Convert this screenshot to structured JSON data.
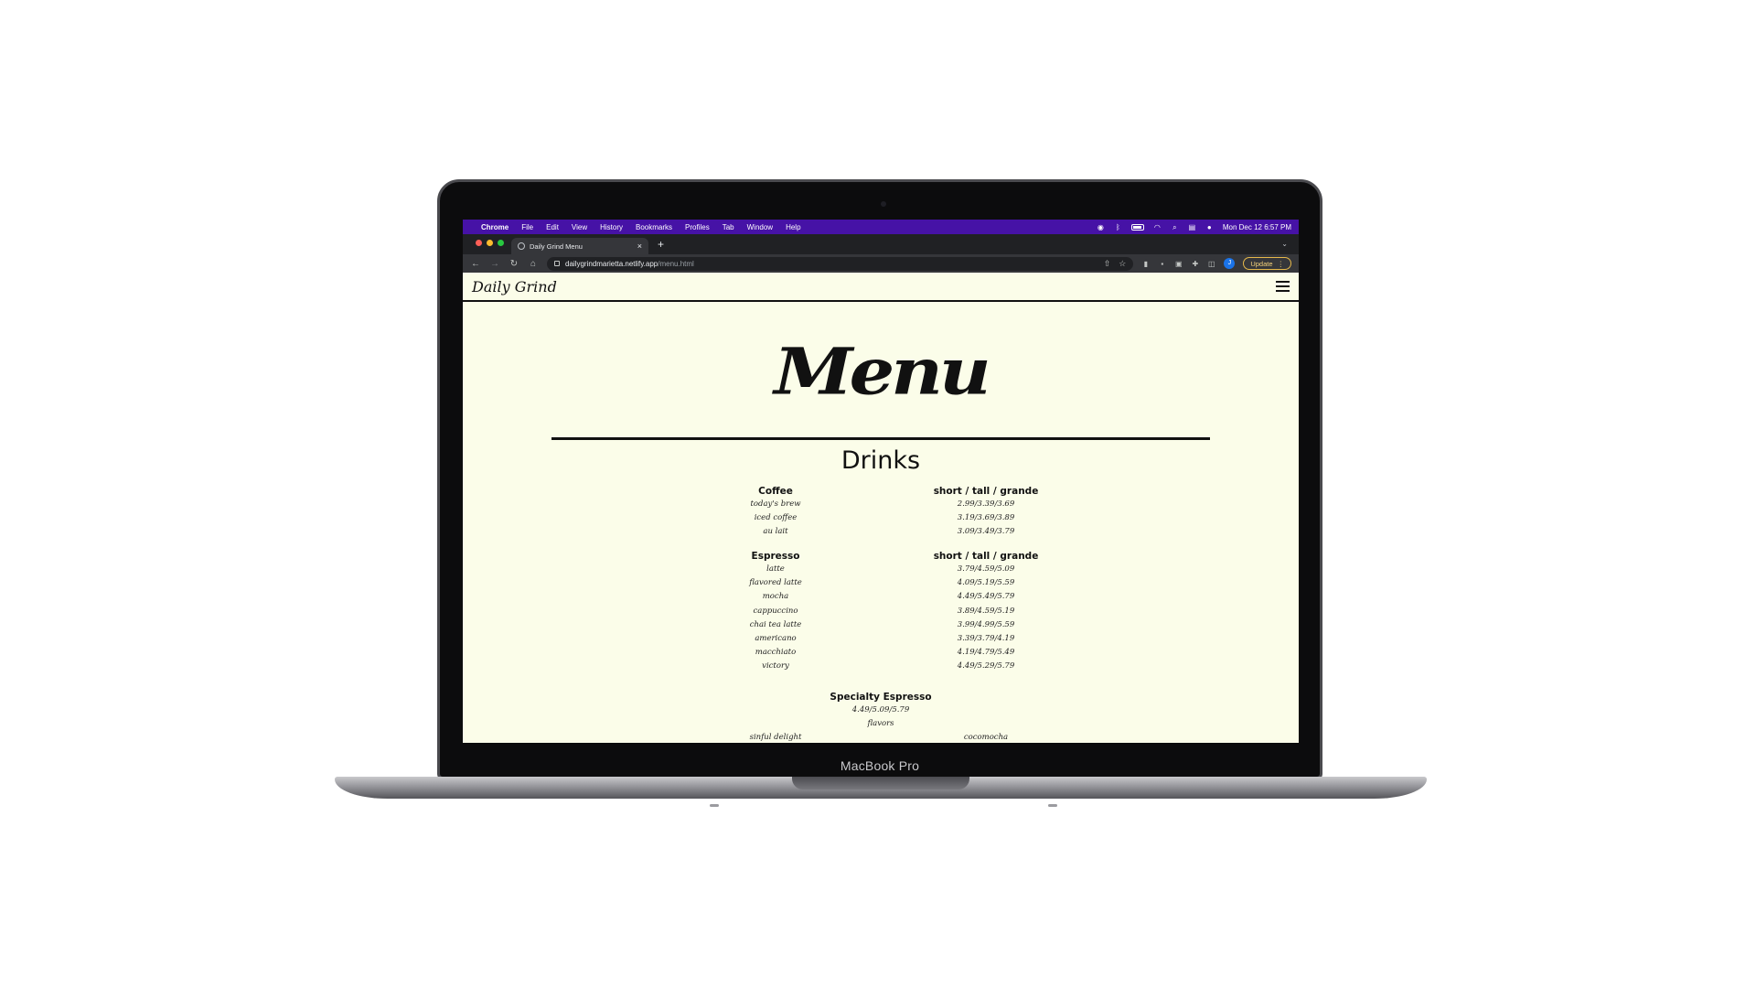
{
  "device": {
    "label": "MacBook Pro"
  },
  "mac_menubar": {
    "app": "Chrome",
    "items": [
      "File",
      "Edit",
      "View",
      "History",
      "Bookmarks",
      "Profiles",
      "Tab",
      "Window",
      "Help"
    ],
    "clock": "Mon Dec 12  6:57 PM"
  },
  "browser": {
    "tab_title": "Daily Grind Menu",
    "url_host": "dailygrindmarietta.netlify.app",
    "url_path": "/menu.html",
    "update_label": "Update",
    "profile_initial": "J"
  },
  "site": {
    "brand": "Daily Grind",
    "title": "Menu",
    "section_title": "Drinks",
    "coffee": {
      "heading": "Coffee",
      "size_heading": "short / tall / grande",
      "items": [
        {
          "name": "today's brew",
          "price": "2.99/3.39/3.69"
        },
        {
          "name": "iced coffee",
          "price": "3.19/3.69/3.89"
        },
        {
          "name": "au lait",
          "price": "3.09/3.49/3.79"
        }
      ]
    },
    "espresso": {
      "heading": "Espresso",
      "size_heading": "short / tall / grande",
      "items": [
        {
          "name": "latte",
          "price": "3.79/4.59/5.09"
        },
        {
          "name": "flavored latte",
          "price": "4.09/5.19/5.59"
        },
        {
          "name": "mocha",
          "price": "4.49/5.49/5.79"
        },
        {
          "name": "cappuccino",
          "price": "3.89/4.59/5.19"
        },
        {
          "name": "chai tea latte",
          "price": "3.99/4.99/5.59"
        },
        {
          "name": "americano",
          "price": "3.39/3.79/4.19"
        },
        {
          "name": "macchiato",
          "price": "4.19/4.79/5.49"
        },
        {
          "name": "victory",
          "price": "4.49/5.29/5.79"
        }
      ]
    },
    "specialty": {
      "heading": "Specialty Espresso",
      "price": "4.49/5.09/5.79",
      "subheading": "flavors",
      "items_left": [
        "sinful delight"
      ],
      "items_right": [
        "cocomocha"
      ]
    }
  }
}
